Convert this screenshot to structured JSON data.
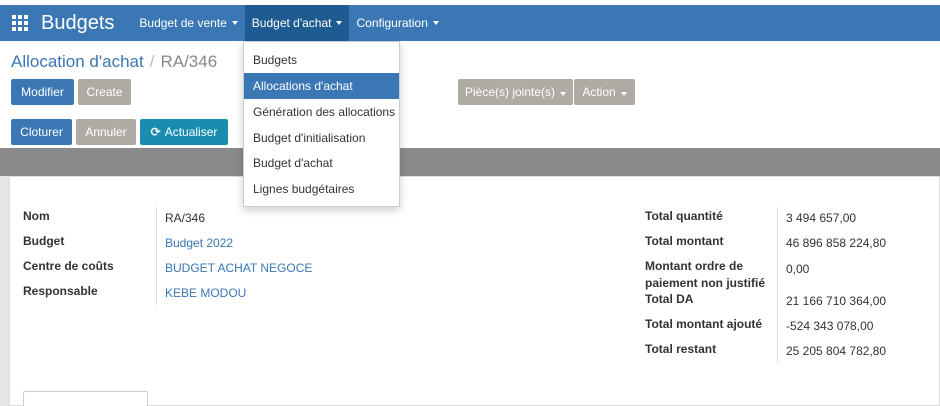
{
  "app": {
    "title": "Budgets"
  },
  "nav": {
    "items": [
      {
        "label": "Budget de vente"
      },
      {
        "label": "Budget d'achat"
      },
      {
        "label": "Configuration"
      }
    ]
  },
  "breadcrumb": {
    "parent": "Allocation d'achat",
    "current": "RA/346"
  },
  "toolbar": {
    "edit_label": "Modifier",
    "create_label": "Create",
    "attachments_label": "Pièce(s) jointe(s)",
    "action_label": "Action"
  },
  "statusbar": {
    "close_label": "Cloturer",
    "cancel_label": "Annuler",
    "refresh_label": "Actualiser"
  },
  "dropdown": {
    "items": [
      {
        "label": "Budgets"
      },
      {
        "label": "Allocations d'achat"
      },
      {
        "label": "Génération des allocations"
      },
      {
        "label": "Budget d'initialisation"
      },
      {
        "label": "Budget d'achat"
      },
      {
        "label": "Lignes budgétaires"
      }
    ]
  },
  "form": {
    "left": [
      {
        "label": "Nom",
        "value": "RA/346"
      },
      {
        "label": "Budget",
        "value": "Budget 2022"
      },
      {
        "label": "Centre de coûts",
        "value": "BUDGET ACHAT NEGOCE"
      },
      {
        "label": "Responsable",
        "value": "KEBE MODOU"
      }
    ],
    "right": [
      {
        "label": "Total quantité",
        "value": "3 494 657,00"
      },
      {
        "label": "Total montant",
        "value": "46 896 858 224,80"
      },
      {
        "label": "Montant ordre de",
        "label2": "paiement non justifié",
        "value": "0,00"
      },
      {
        "label": "Total DA",
        "value": "21 166 710 364,00"
      },
      {
        "label": "Total montant ajouté",
        "value": "-524 343 078,00"
      },
      {
        "label": "Total restant",
        "value": "25 205 804 782,80"
      }
    ]
  }
}
